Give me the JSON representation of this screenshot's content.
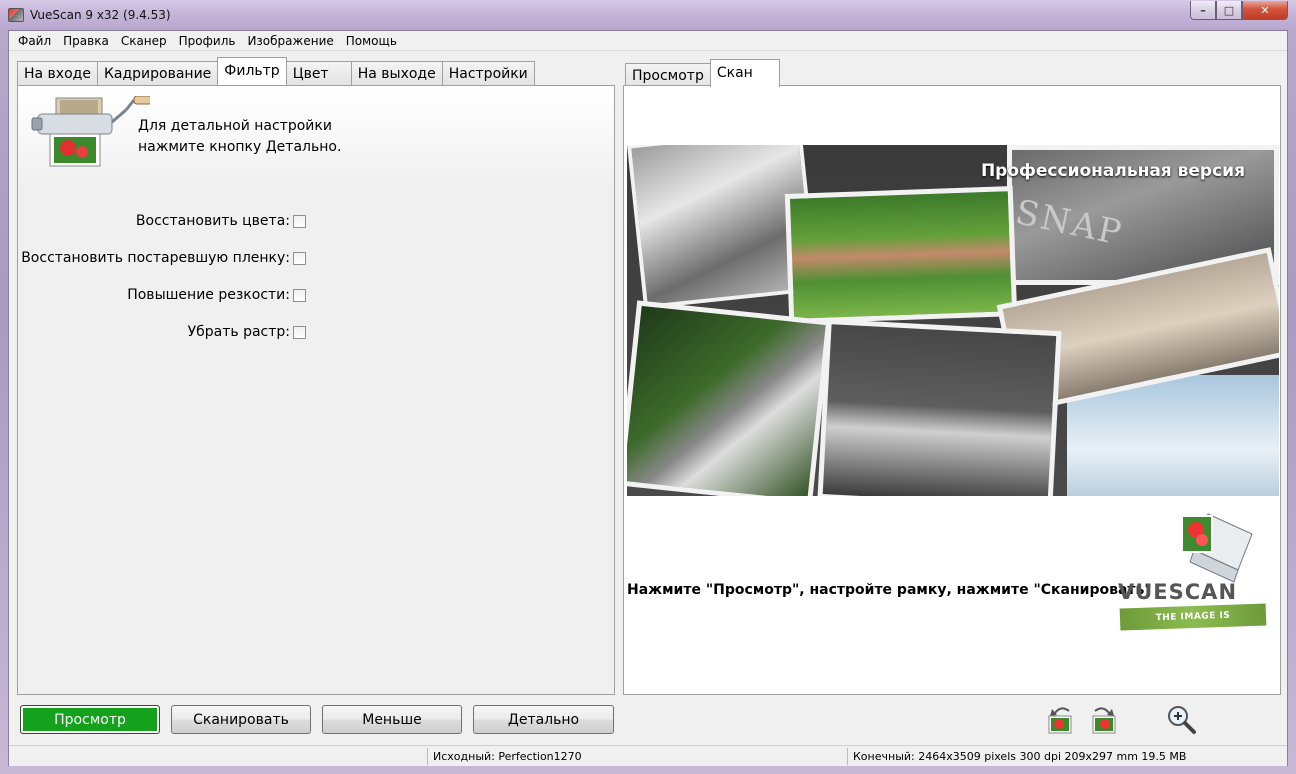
{
  "window": {
    "title": "VueScan 9 x32 (9.4.53)",
    "controls": {
      "minimize": "–",
      "maximize": "□",
      "close": "✕"
    }
  },
  "menu": [
    "Файл",
    "Правка",
    "Сканер",
    "Профиль",
    "Изображение",
    "Помощь"
  ],
  "left_tabs": [
    {
      "label": "На входе",
      "active": false
    },
    {
      "label": "Кадрирование",
      "active": false
    },
    {
      "label": "Фильтр",
      "active": true
    },
    {
      "label": "Цвет",
      "active": false
    },
    {
      "label": "На выходе",
      "active": false
    },
    {
      "label": "Настройки",
      "active": false
    }
  ],
  "filter_panel": {
    "hint_line1": "Для детальной настройки",
    "hint_line2": "нажмите кнопку Детально.",
    "options": [
      {
        "label": "Восстановить цвета:",
        "checked": false
      },
      {
        "label": "Восстановить постаревшую пленку:",
        "checked": false
      },
      {
        "label": "Повышение резкости:",
        "checked": false
      },
      {
        "label": "Убрать растр:",
        "checked": false
      }
    ]
  },
  "right_tabs": [
    {
      "label": "Просмотр",
      "active": false
    },
    {
      "label": "Скан",
      "active": true
    }
  ],
  "scan_panel": {
    "banner_title": "Профессиональная версия",
    "banner_snap": "SNAP",
    "instruction": "Нажмите \"Просмотр\", настройте рамку, нажмите \"Сканировать\"",
    "logo_text": "VUESCAN",
    "logo_tagline": "THE IMAGE IS EVERYTHING"
  },
  "buttons": {
    "preview": "Просмотр",
    "scan": "Сканировать",
    "less": "Меньше",
    "more": "Детально"
  },
  "status": {
    "source": "Исходный: Perfection1270",
    "destination": "Конечный: 2464x3509 pixels 300 dpi 209x297 mm 19.5 MB"
  },
  "colors": {
    "preview_button": "#14a11b",
    "title_bar": "#c4b4d8"
  }
}
